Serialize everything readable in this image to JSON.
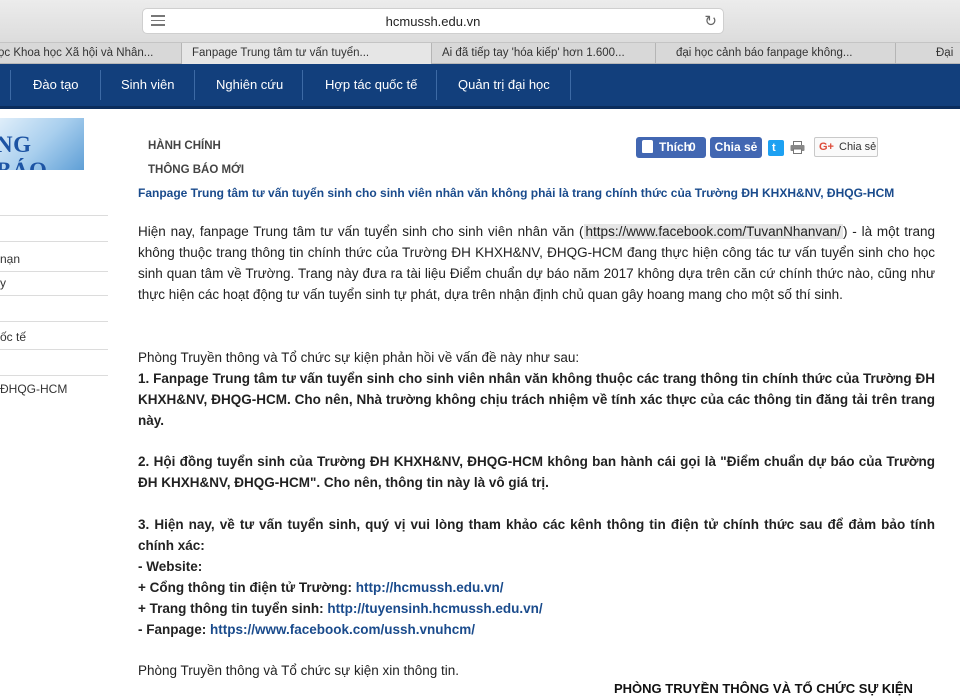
{
  "browser": {
    "url": "hcmussh.edu.vn",
    "tabs": [
      "ọc Khoa học Xã hội và Nhân...",
      "Fanpage Trung tâm tư vấn tuyển...",
      "Ai đã tiếp tay 'hóa kiếp' hơn 1.600...",
      "đại học cảnh báo fanpage không...",
      "Đại"
    ]
  },
  "nav": {
    "items": [
      "Đào tạo",
      "Sinh viên",
      "Nghiên cứu",
      "Hợp tác quốc tế",
      "Quản trị đại học"
    ]
  },
  "sidebar": {
    "logo_text": "NG BÁO",
    "items": [
      "",
      "",
      "nạn",
      "y",
      "",
      "ốc tế",
      "",
      "ĐHQG-HCM"
    ]
  },
  "breadcrumb": {
    "category": "HÀNH CHÍNH",
    "subcategory": "THÔNG BÁO MỚI"
  },
  "share": {
    "like_label": "Thích",
    "like_count": "0",
    "fb_share_label": "Chia sẻ",
    "gplus_icon": "G+",
    "gplus_label": "Chia sẻ",
    "twitter_glyph": "t"
  },
  "article": {
    "title": "Fanpage Trung tâm tư vấn tuyển sinh cho sinh viên nhân văn không phải là trang chính thức của Trường ĐH KHXH&NV, ĐHQG-HCM",
    "intro_before": "Hiện nay, fanpage Trung tâm tư vấn tuyển sinh cho sinh viên nhân văn (",
    "intro_url": "https://www.facebook.com/TuvanNhanvan/",
    "intro_after": ") - là một trang không thuộc trang thông tin chính thức của Trường ĐH KHXH&NV, ĐHQG-HCM đang thực hiện công tác tư vấn tuyển sinh cho học sinh quan tâm về Trường. Trang này đưa ra tài liệu Điểm chuẩn dự báo năm 2017 không dựa trên căn cứ chính thức nào, cũng như thực hiện các hoạt động tư vấn tuyển sinh tự phát, dựa trên nhận định chủ quan gây hoang mang cho một số thí sinh.",
    "response_intro": "Phòng Truyền thông và Tổ chức sự kiện phản hồi về vấn đề này như sau:",
    "point1": "1. Fanpage Trung tâm tư vấn tuyển sinh cho sinh viên nhân văn  không thuộc các trang thông tin chính thức của Trường ĐH KHXH&NV, ĐHQG-HCM. Cho nên, Nhà trường không chịu trách nhiệm về tính xác thực của các thông tin đăng tải trên trang này.",
    "point2": "2. Hội đồng tuyển sinh của Trường ĐH KHXH&NV, ĐHQG-HCM không ban hành cái gọi là \"Điểm chuẩn dự báo của Trường ĐH KHXH&NV, ĐHQG-HCM\". Cho nên, thông tin này là vô giá trị.",
    "point3": "3. Hiện nay, về tư vấn tuyển sinh, quý vị vui lòng tham khảo các kênh thông tin điện tử chính thức sau để đảm bảo tính chính xác:",
    "website_label": "- Website:",
    "portal_label": "+ Cổng thông tin điện tử Trường: ",
    "portal_url": "http://hcmussh.edu.vn/",
    "admissions_label": "+ Trang thông tin tuyển sinh: ",
    "admissions_url": "http://tuyensinh.hcmussh.edu.vn/",
    "fanpage_label": "- Fanpage: ",
    "fanpage_url": "https://www.facebook.com/ussh.vnuhcm/",
    "closing": "Phòng Truyền thông và Tổ chức sự kiện xin thông tin.",
    "signature": "PHÒNG TRUYỀN THÔNG VÀ TỔ CHỨC SỰ KIỆN"
  }
}
